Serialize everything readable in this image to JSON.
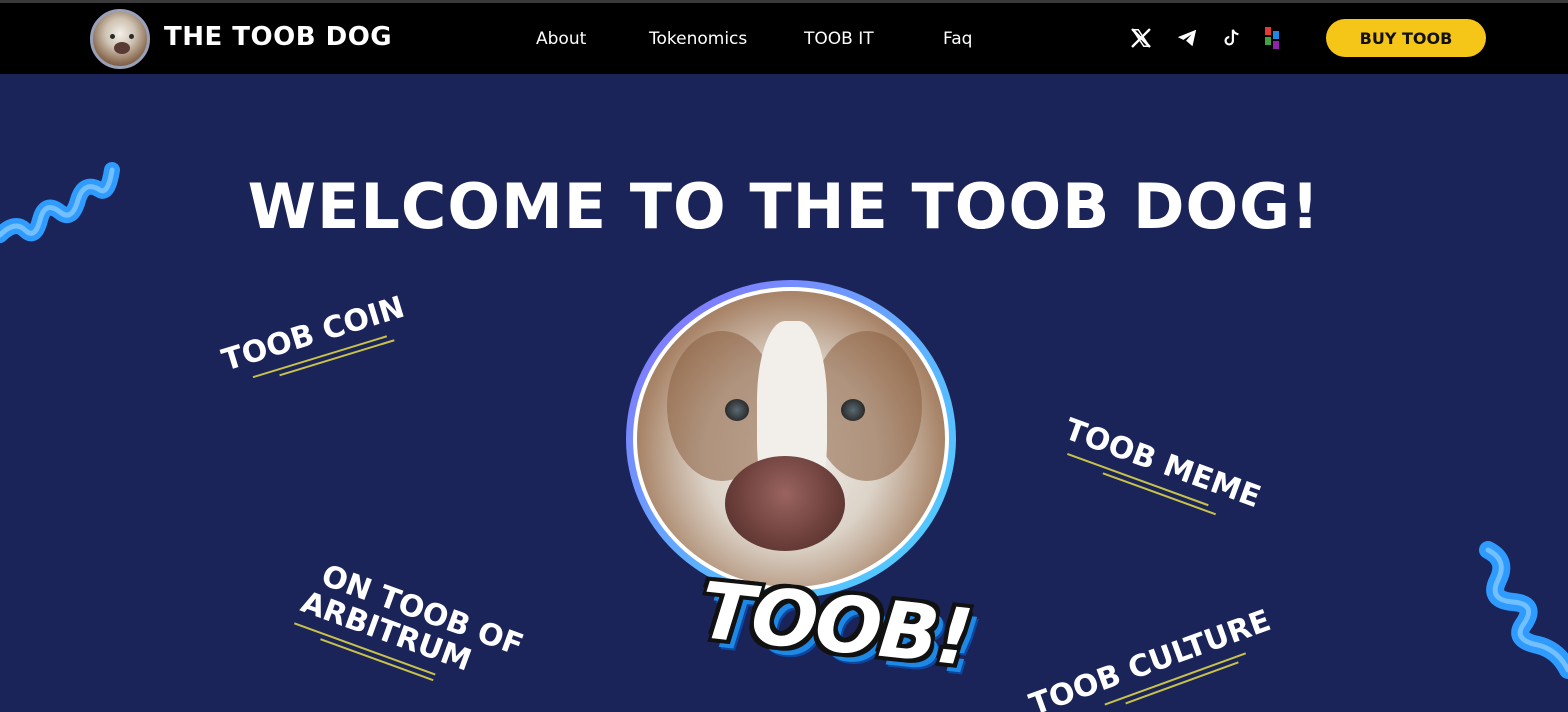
{
  "header": {
    "brand": "THE TOOB DOG",
    "nav": [
      "About",
      "Tokenomics",
      "TOOB IT",
      "Faq"
    ],
    "social": [
      "x-icon",
      "telegram-icon",
      "tiktok-icon",
      "dextools-icon"
    ],
    "buy_label": "BUY TOOB"
  },
  "hero": {
    "title": "WELCOME TO THE TOOB DOG!",
    "tags": {
      "coin": "TOOB COIN",
      "meme": "TOOB MEME",
      "arbitrum_line1": "ON TOOB OF",
      "arbitrum_line2": "ARBITRUM",
      "culture": "TOOB CULTURE"
    },
    "badge": "TOOB!"
  },
  "colors": {
    "background": "#1a2459",
    "header": "#000000",
    "accent": "#f5c518",
    "ribbon": "#2f9bff"
  }
}
